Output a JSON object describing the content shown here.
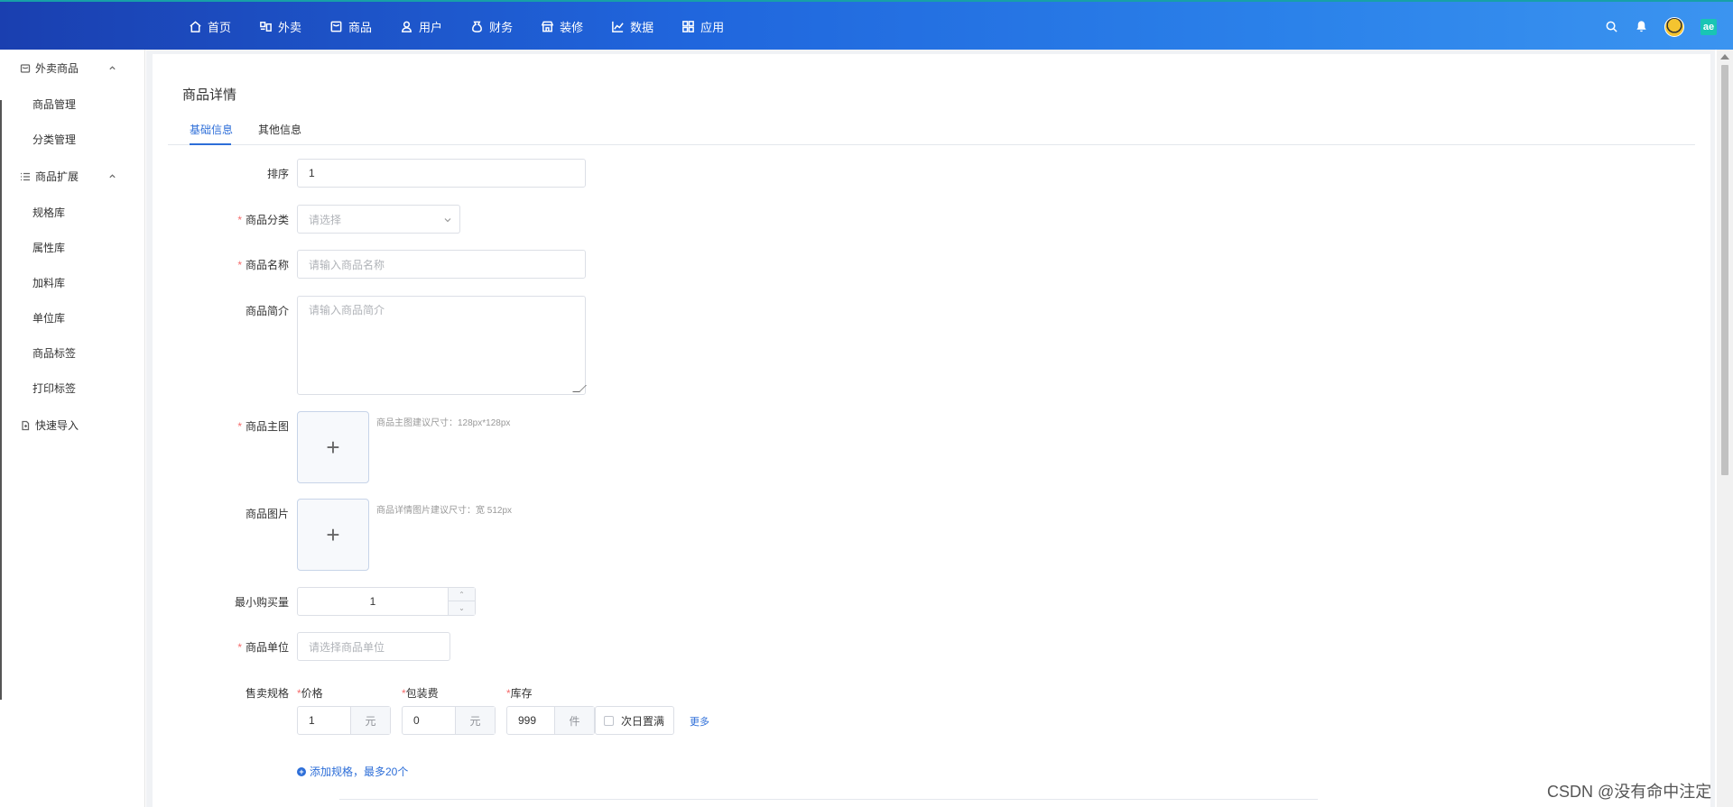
{
  "topnav": {
    "items": [
      {
        "label": "首页",
        "icon": "home-icon"
      },
      {
        "label": "外卖",
        "icon": "takeout-icon"
      },
      {
        "label": "商品",
        "icon": "product-icon"
      },
      {
        "label": "用户",
        "icon": "user-icon"
      },
      {
        "label": "财务",
        "icon": "finance-icon"
      },
      {
        "label": "装修",
        "icon": "store-icon"
      },
      {
        "label": "数据",
        "icon": "chart-icon"
      },
      {
        "label": "应用",
        "icon": "apps-icon"
      }
    ],
    "right_icons": [
      "search-icon",
      "bell-icon",
      "avatar",
      "ai-badge-icon"
    ],
    "ai_badge": "ae"
  },
  "sidebar": {
    "groups": [
      {
        "label": "外卖商品",
        "items": [
          "商品管理",
          "分类管理"
        ]
      },
      {
        "label": "商品扩展",
        "items": [
          "规格库",
          "属性库",
          "加料库",
          "单位库",
          "商品标签",
          "打印标签"
        ]
      }
    ],
    "quick_import": "快速导入"
  },
  "page": {
    "title": "商品详情",
    "tabs": [
      "基础信息",
      "其他信息"
    ],
    "active_tab": "基础信息"
  },
  "form": {
    "sort": {
      "label": "排序",
      "value": "1"
    },
    "category": {
      "label": "商品分类",
      "placeholder": "请选择"
    },
    "name": {
      "label": "商品名称",
      "placeholder": "请输入商品名称"
    },
    "intro": {
      "label": "商品简介",
      "placeholder": "请输入商品简介"
    },
    "main_image": {
      "label": "商品主图",
      "hint": "商品主图建议尺寸：128px*128px"
    },
    "images": {
      "label": "商品图片",
      "hint": "商品详情图片建议尺寸：宽 512px"
    },
    "min_qty": {
      "label": "最小购买量",
      "value": "1"
    },
    "unit": {
      "label": "商品单位",
      "placeholder": "请选择商品单位"
    },
    "spec": {
      "label": "售卖规格",
      "price": {
        "label": "价格",
        "value": "1",
        "unit": "元"
      },
      "packing": {
        "label": "包装费",
        "value": "0",
        "unit": "元"
      },
      "stock": {
        "label": "库存",
        "value": "999",
        "unit": "件"
      },
      "next_day_full": "次日置满",
      "more": "更多",
      "add": "添加规格，最多20个"
    }
  },
  "watermark": "CSDN @没有命中注定",
  "colors": {
    "accent": "#2d6ed8",
    "required": "#f56c6c",
    "nav_gradient_start": "#1a3fb0",
    "nav_gradient_end": "#3b94f0"
  }
}
